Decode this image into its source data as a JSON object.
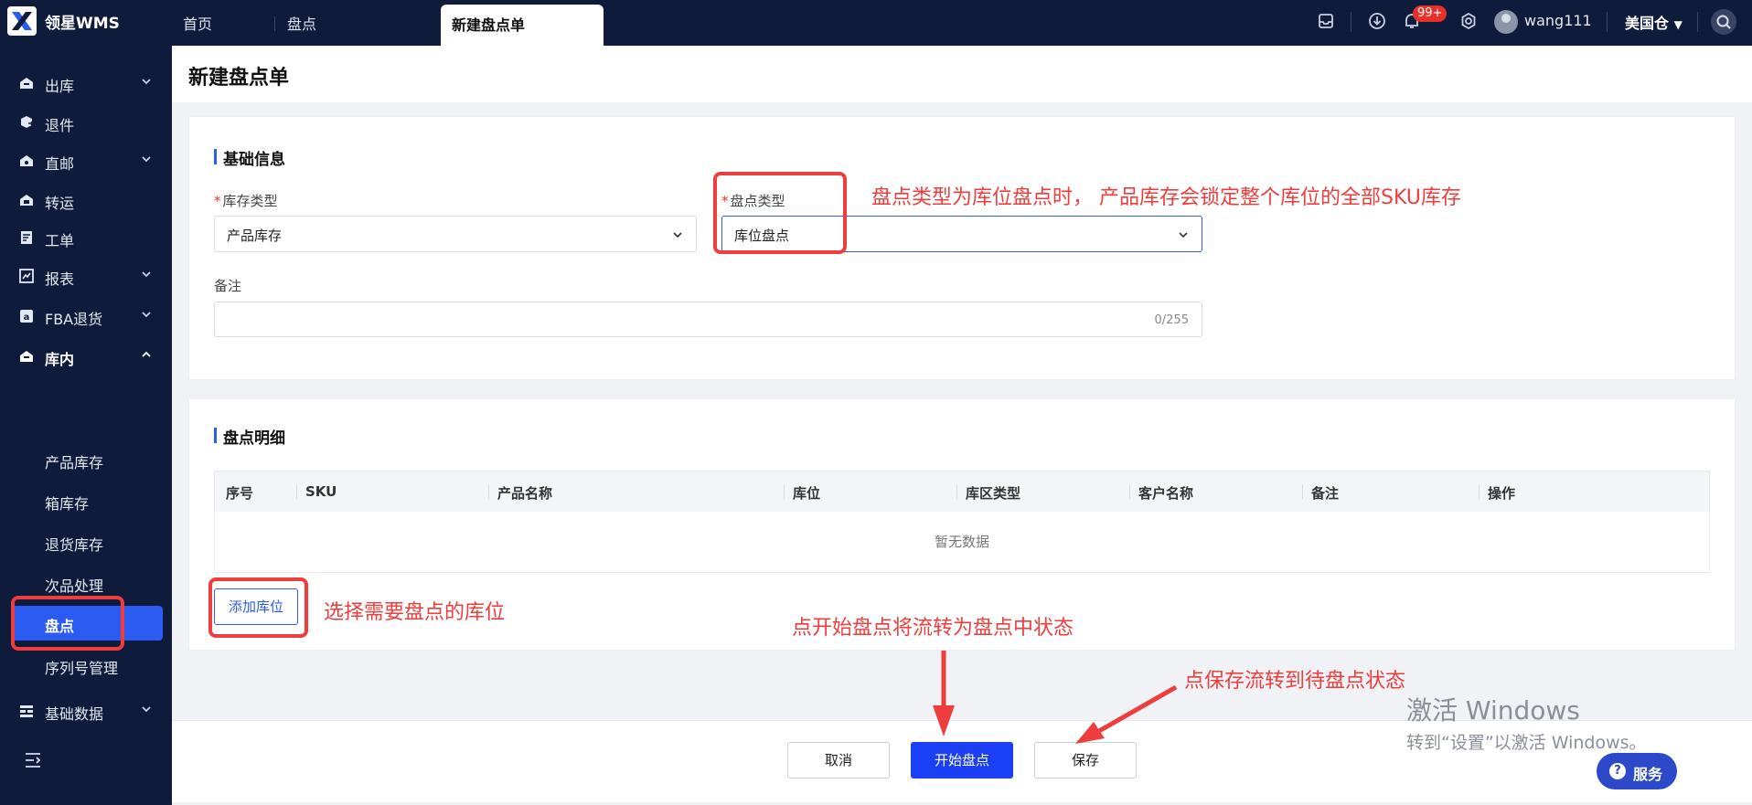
{
  "app": {
    "brand": "领星WMS"
  },
  "tabs": [
    {
      "label": "首页"
    },
    {
      "label": "盘点"
    },
    {
      "label": "新建盘点单"
    }
  ],
  "topbar": {
    "notification_count": "99+",
    "username": "wang111",
    "warehouse": "美国仓"
  },
  "sidebar": {
    "items": [
      {
        "label": "出库",
        "icon": "outbound-icon",
        "expandable": true
      },
      {
        "label": "退件",
        "icon": "return-icon",
        "expandable": false
      },
      {
        "label": "直邮",
        "icon": "direct-mail-icon",
        "expandable": true
      },
      {
        "label": "转运",
        "icon": "transfer-icon",
        "expandable": false
      },
      {
        "label": "工单",
        "icon": "work-order-icon",
        "expandable": false
      },
      {
        "label": "报表",
        "icon": "report-icon",
        "expandable": true
      },
      {
        "label": "FBA退货",
        "icon": "amazon-icon",
        "expandable": true
      },
      {
        "label": "库内",
        "icon": "warehouse-icon",
        "expandable": true,
        "expanded": true
      },
      {
        "label": "基础数据",
        "icon": "base-data-icon",
        "expandable": true
      }
    ],
    "sub_items": [
      {
        "label": "产品库存"
      },
      {
        "label": "箱库存"
      },
      {
        "label": "退货库存"
      },
      {
        "label": "次品处理"
      },
      {
        "label": "盘点",
        "active": true
      },
      {
        "label": "序列号管理"
      }
    ]
  },
  "page": {
    "title": "新建盘点单",
    "basic_section_title": "基础信息",
    "inventory_type_label": "库存类型",
    "inventory_type_value": "产品库存",
    "count_type_label": "盘点类型",
    "count_type_value": "库位盘点",
    "remark_label": "备注",
    "remark_counter": "0/255",
    "detail_section_title": "盘点明细",
    "table_headers": [
      "序号",
      "SKU",
      "产品名称",
      "库位",
      "库区类型",
      "客户名称",
      "备注",
      "操作"
    ],
    "empty_text": "暂无数据",
    "add_location_button": "添加库位"
  },
  "footer": {
    "cancel": "取消",
    "start_count": "开始盘点",
    "save": "保存"
  },
  "annotations": {
    "count_type_note": "盘点类型为库位盘点时， 产品库存会锁定整个库位的全部SKU库存",
    "add_location_note": "选择需要盘点的库位",
    "start_note": "点开始盘点将流转为盘点中状态",
    "save_note": "点保存流转到待盘点状态"
  },
  "windows_activation": {
    "line1": "激活 Windows",
    "line2": "转到“设置”以激活 Windows。"
  },
  "service_button": "服务",
  "colors": {
    "nav_bg": "#0f1b3a",
    "accent": "#2b5bf0",
    "annotation": "#ee3d3d"
  }
}
